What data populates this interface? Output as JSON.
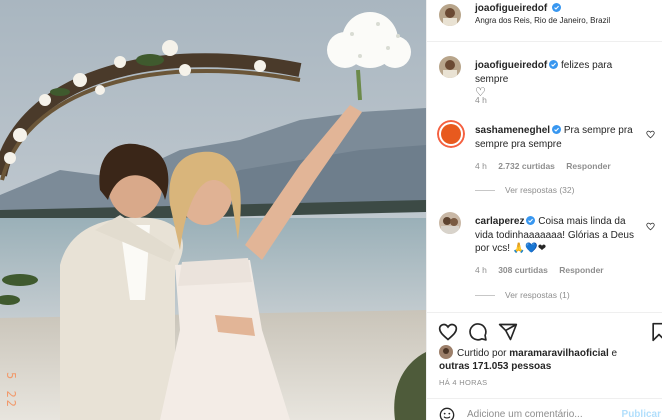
{
  "post": {
    "author": "joaofigueiredof",
    "location": "Angra dos Reis, Rio de Janeiro, Brazil",
    "photo_date_stamp": "5 22"
  },
  "caption": {
    "author": "joaofigueiredof",
    "text": "felizes para sempre",
    "emoji": "♡",
    "time": "4 h"
  },
  "comments": [
    {
      "author": "sashameneghel",
      "text": "Pra sempre pra sempre pra sempre",
      "time": "4 h",
      "likes": "2.732 curtidas",
      "reply_label": "Responder",
      "view_replies": "Ver respostas (32)"
    },
    {
      "author": "carlaperez",
      "text": "Coisa mais linda da vida todinhaaaaaaa! Glórias a Deus por vcs! 🙏💙❤",
      "time": "4 h",
      "likes": "308 curtidas",
      "reply_label": "Responder",
      "view_replies": "Ver respostas (1)"
    }
  ],
  "likes": {
    "prefix": "Curtido por",
    "user": "maramaravilhaoficial",
    "joiner": "e",
    "others": "outras 171.053 pessoas"
  },
  "posted_ago": "HÁ 4 HORAS",
  "add_comment": {
    "placeholder": "Adicione um comentário...",
    "publish_label": "Publicar"
  },
  "colors": {
    "verified": "#3897f0",
    "link_disabled": "#b2dffc",
    "story_ring": "#f56040"
  },
  "icons": [
    "verified-icon",
    "heart-icon",
    "comment-icon",
    "share-icon",
    "bookmark-icon",
    "emoji-icon"
  ]
}
